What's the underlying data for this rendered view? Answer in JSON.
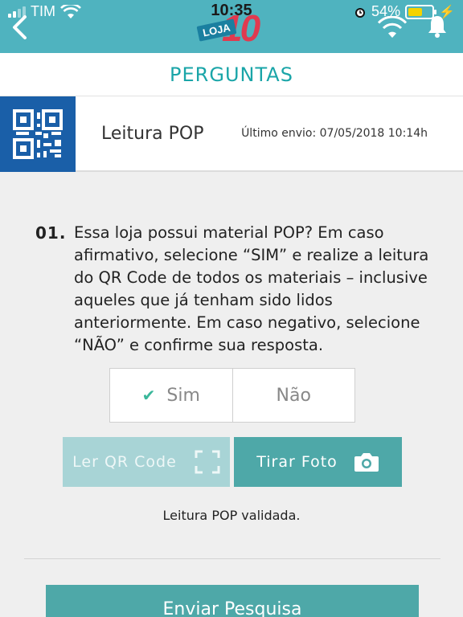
{
  "status_bar": {
    "carrier": "TIM",
    "time": "10:35",
    "battery": "54%",
    "battery_level": 0.54
  },
  "header": {
    "logo_text": "LOJA",
    "logo_number": "10"
  },
  "page": {
    "title": "PERGUNTAS"
  },
  "item": {
    "title": "Leitura POP",
    "last_sent": "Último envio: 07/05/2018 10:14h"
  },
  "question": {
    "number": "01.",
    "text": "Essa loja possui material POP? Em caso afirmativo, selecione “SIM” e realize a leitura do QR Code de todos os materiais – inclusive aqueles que já tenham sido lidos anteriormente. Em caso negativo, selecione “NÃO” e confirme sua resposta."
  },
  "choices": {
    "yes_label": "Sim",
    "no_label": "Não",
    "selected": "Sim"
  },
  "actions": {
    "qr_label": "Ler QR Code",
    "photo_label": "Tirar Foto"
  },
  "status_message": "Leitura POP validada.",
  "submit_label": "Enviar Pesquisa",
  "colors": {
    "header_bg": "#4fb3bf",
    "accent": "#1aa5a8",
    "button": "#4ea8a8",
    "button_disabled": "#a8d4d6",
    "qr_bg": "#1a5fa8"
  }
}
